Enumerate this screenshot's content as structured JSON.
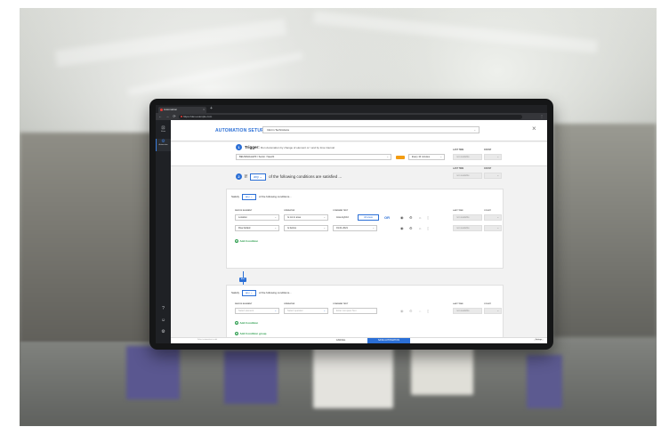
{
  "browser": {
    "tab_title": "Automation",
    "url": "https://dev.example.com",
    "nav_icons": "← → ⟳ ⌂",
    "menu_icon": "⋮",
    "new_tab": "+"
  },
  "sidebar": {
    "items": [
      {
        "label": "Views",
        "icon": "dashboard-icon"
      },
      {
        "label": "Automation",
        "icon": "automation-icon",
        "active": true
      }
    ],
    "bottom_icons": [
      "help-icon",
      "user-icon",
      "settings-icon"
    ]
  },
  "header": {
    "title": "AUTOMATION SETUP",
    "name_value": "Inform Technicians",
    "close_label": "×"
  },
  "trigger": {
    "step": "1",
    "label": "Trigger:",
    "description": "Run Automation by change of element or / and by time interval",
    "path_value": "BEUSRHGLHPF / Sector / Sauchl",
    "interval_value": "Every 10 minutes",
    "last_time_label": "LAST TIME",
    "count_label": "COUNT",
    "last_time_value": "not available"
  },
  "condition": {
    "step": "2",
    "if_label": "If",
    "any_label": "any",
    "rest_label": "of the following conditions are satisfied ...",
    "last_time_label": "LAST TIME",
    "count_label": "COUNT",
    "last_time_value": "not available"
  },
  "group1": {
    "satisfy_label": "Satisfy",
    "any_label": "any",
    "rest_label": "of the following conditions...",
    "headers": {
      "element": "DEVICE ELEMENT",
      "operator": "OPERATOR",
      "compare": "COMPARE TEXT",
      "last_time": "LAST TIME",
      "count": "COUNT"
    },
    "rows": [
      {
        "element": "Location",
        "operator": "Is not in area",
        "compare": "Area Hybrid",
        "button": "All areas",
        "or": "OR",
        "last_time": "not available"
      },
      {
        "element": "Row Added",
        "operator": "Is before",
        "compare": "01.01.2021",
        "last_time": "not available"
      }
    ],
    "add_condition": "Add Condition"
  },
  "and_label": "AND",
  "group2": {
    "satisfy_label": "Satisfy",
    "any_label": "any",
    "rest_label": "of the following conditions...",
    "headers": {
      "element": "DEVICE ELEMENT",
      "operator": "OPERATOR",
      "compare": "COMPARE TEXT",
      "last_time": "LAST TIME",
      "count": "COUNT"
    },
    "row": {
      "element": "Select element",
      "operator": "Select operator",
      "compare": "Enter compare Text",
      "last_time": "not available"
    },
    "add_condition": "Add Condition"
  },
  "add_group": "Add Condition group",
  "footer": {
    "cancel": "CANCEL",
    "save": "SAVE AUTOMATION",
    "left_text": "Select automation to edit",
    "right_text": "Settings"
  }
}
